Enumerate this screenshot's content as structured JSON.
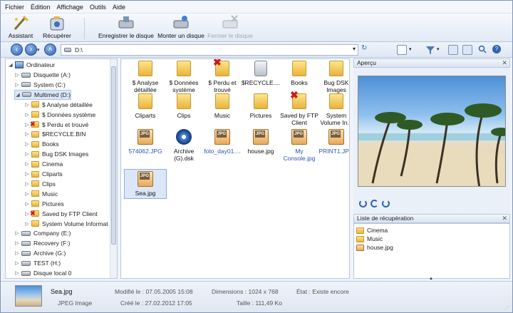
{
  "menu": [
    "Fichier",
    "Édition",
    "Affichage",
    "Outils",
    "Aide"
  ],
  "toolbar": {
    "assistant": "Assistant",
    "recover": "Récupérer",
    "save_disk": "Enregistrer le disque",
    "mount_disk": "Monter un disque",
    "close_disk": "Fermer le disque"
  },
  "address": {
    "path": "D:\\"
  },
  "tree": {
    "root": "Ordinateur",
    "items": [
      {
        "label": "Disquette (A:)",
        "type": "drive"
      },
      {
        "label": "System (C:)",
        "type": "drive"
      },
      {
        "label": "Multimed (D:)",
        "type": "drive"
      },
      {
        "label": "$ Analyse détaillée",
        "type": "folder"
      },
      {
        "label": "$ Données système",
        "type": "folder"
      },
      {
        "label": "$ Perdu et trouvé",
        "type": "folder-x"
      },
      {
        "label": "$RECYCLE.BIN",
        "type": "folder"
      },
      {
        "label": "Books",
        "type": "folder"
      },
      {
        "label": "Bug DSK Images",
        "type": "folder"
      },
      {
        "label": "Cinema",
        "type": "folder"
      },
      {
        "label": "Cliparts",
        "type": "folder"
      },
      {
        "label": "Clips",
        "type": "folder"
      },
      {
        "label": "Music",
        "type": "folder"
      },
      {
        "label": "Pictures",
        "type": "folder"
      },
      {
        "label": "Saved by FTP Client",
        "type": "folder-x"
      },
      {
        "label": "System Volume Informat",
        "type": "folder"
      },
      {
        "label": "Company (E:)",
        "type": "drive"
      },
      {
        "label": "Recovery (F:)",
        "type": "drive"
      },
      {
        "label": "Archive (G:)",
        "type": "drive"
      },
      {
        "label": "TEST (H:)",
        "type": "drive"
      },
      {
        "label": "Disque local 0",
        "type": "drive"
      }
    ]
  },
  "files": [
    {
      "line1": "$ Analyse",
      "line2": "détaillée",
      "type": "folder"
    },
    {
      "line1": "$ Données",
      "line2": "système",
      "type": "folder"
    },
    {
      "line1": "$ Perdu et",
      "line2": "trouvé",
      "type": "folder-x"
    },
    {
      "line1": "$RECYCLE....",
      "line2": "",
      "type": "recycle"
    },
    {
      "line1": "Books",
      "line2": "",
      "type": "folder"
    },
    {
      "line1": "Bug DSK",
      "line2": "Images",
      "type": "folder"
    },
    {
      "line1": "Cliparts",
      "line2": "",
      "type": "folder"
    },
    {
      "line1": "Clips",
      "line2": "",
      "type": "folder"
    },
    {
      "line1": "Music",
      "line2": "",
      "type": "folder"
    },
    {
      "line1": "Pictures",
      "line2": "",
      "type": "folder"
    },
    {
      "line1": "Saved by FTP",
      "line2": "Client",
      "type": "folder-x"
    },
    {
      "line1": "System",
      "line2": "Volume In...",
      "type": "folder"
    },
    {
      "line1": "574062.JPG",
      "line2": "",
      "type": "jpg-blue"
    },
    {
      "line1": "Archive",
      "line2": "(G).dsk",
      "type": "dsk"
    },
    {
      "line1": "foto_day01....",
      "line2": "",
      "type": "jpg-blue"
    },
    {
      "line1": "house.jpg",
      "line2": "",
      "type": "jpg"
    },
    {
      "line1": "My",
      "line2": "Console.jpg",
      "type": "jpg-blue"
    },
    {
      "line1": "PRINT1.JPG",
      "line2": "",
      "type": "jpg-blue"
    },
    {
      "line1": "Sea.jpg",
      "line2": "",
      "type": "jpg-sel"
    }
  ],
  "preview": {
    "title": "Aperçu"
  },
  "recovery": {
    "title": "Liste de récupération",
    "items": [
      {
        "label": "Cinema",
        "type": "folder"
      },
      {
        "label": "Music",
        "type": "folder"
      },
      {
        "label": "house.jpg",
        "type": "jpg"
      }
    ]
  },
  "status": {
    "name": "Sea.jpg",
    "type": "JPEG Image",
    "modified": "Modifié le : 07.05.2005 15:08",
    "created": "Créé le : 27.02.2012 17:05",
    "dimensions": "Dimensions : 1024 x 768",
    "size": "Taille : 111,49 Ko",
    "state": "État :  Existe encore"
  }
}
